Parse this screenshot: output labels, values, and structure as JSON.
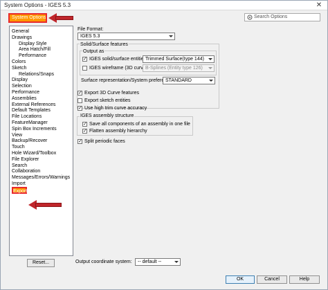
{
  "window": {
    "title": "System Options - IGES 5.3",
    "close_glyph": "✕"
  },
  "tabs": {
    "system_options": "System Options",
    "document_properties": ""
  },
  "search": {
    "placeholder": "Search Options",
    "icon": "search-icon"
  },
  "sidebar": {
    "items": [
      {
        "label": "General",
        "indent": 0
      },
      {
        "label": "Drawings",
        "indent": 0
      },
      {
        "label": "Display Style",
        "indent": 1
      },
      {
        "label": "Area Hatch/Fill",
        "indent": 1
      },
      {
        "label": "Performance",
        "indent": 1
      },
      {
        "label": "Colors",
        "indent": 0
      },
      {
        "label": "Sketch",
        "indent": 0
      },
      {
        "label": "Relations/Snaps",
        "indent": 1
      },
      {
        "label": "Display",
        "indent": 0
      },
      {
        "label": "Selection",
        "indent": 0
      },
      {
        "label": "Performance",
        "indent": 0
      },
      {
        "label": "Assemblies",
        "indent": 0
      },
      {
        "label": "External References",
        "indent": 0
      },
      {
        "label": "Default Templates",
        "indent": 0
      },
      {
        "label": "File Locations",
        "indent": 0
      },
      {
        "label": "FeatureManager",
        "indent": 0
      },
      {
        "label": "Spin Box Increments",
        "indent": 0
      },
      {
        "label": "View",
        "indent": 0
      },
      {
        "label": "Backup/Recover",
        "indent": 0
      },
      {
        "label": "Touch",
        "indent": 0
      },
      {
        "label": "Hole Wizard/Toolbox",
        "indent": 0
      },
      {
        "label": "File Explorer",
        "indent": 0
      },
      {
        "label": "Search",
        "indent": 0
      },
      {
        "label": "Collaboration",
        "indent": 0
      },
      {
        "label": "Messages/Errors/Warnings",
        "indent": 0
      },
      {
        "label": "Import",
        "indent": 0
      },
      {
        "label": "Export",
        "indent": 0,
        "selected": true
      }
    ],
    "reset_label": "Reset..."
  },
  "main": {
    "file_format_label": "File Format:",
    "file_format_value": "IGES 5.3",
    "solid_surface_label": "Solid/Surface features",
    "output_as_label": "Output as",
    "iges_solid_label": "IGES solid/surface entities:",
    "iges_solid_checked": true,
    "iges_solid_value": "Trimmed Surface(type 144)",
    "iges_wireframe_label": "IGES wireframe (3D curves):",
    "iges_wireframe_checked": false,
    "iges_wireframe_value": "B-Splines (Entity type 126)",
    "surface_rep_label": "Surface representation/System preference:",
    "surface_rep_value": "STANDARD",
    "export_3d_curve_label": "Export 3D Curve features",
    "export_3d_curve_checked": true,
    "export_sketch_label": "Export sketch entities",
    "export_sketch_checked": false,
    "high_trim_label": "Use high trim curve accuracy",
    "high_trim_checked": true,
    "assembly_structure_label": "IGES assembly structure",
    "save_all_label": "Save all components of an assembly in one file",
    "save_all_checked": true,
    "flatten_label": "Flatten assembly hierarchy",
    "flatten_checked": true,
    "split_periodic_label": "Split periodic faces",
    "split_periodic_checked": true,
    "output_coord_label": "Output coordinate system:",
    "output_coord_value": "-- default --"
  },
  "footer": {
    "ok": "OK",
    "cancel": "Cancel",
    "help": "Help"
  },
  "colors": {
    "highlight": "#ff9800",
    "annotation_red": "#c0262b"
  }
}
